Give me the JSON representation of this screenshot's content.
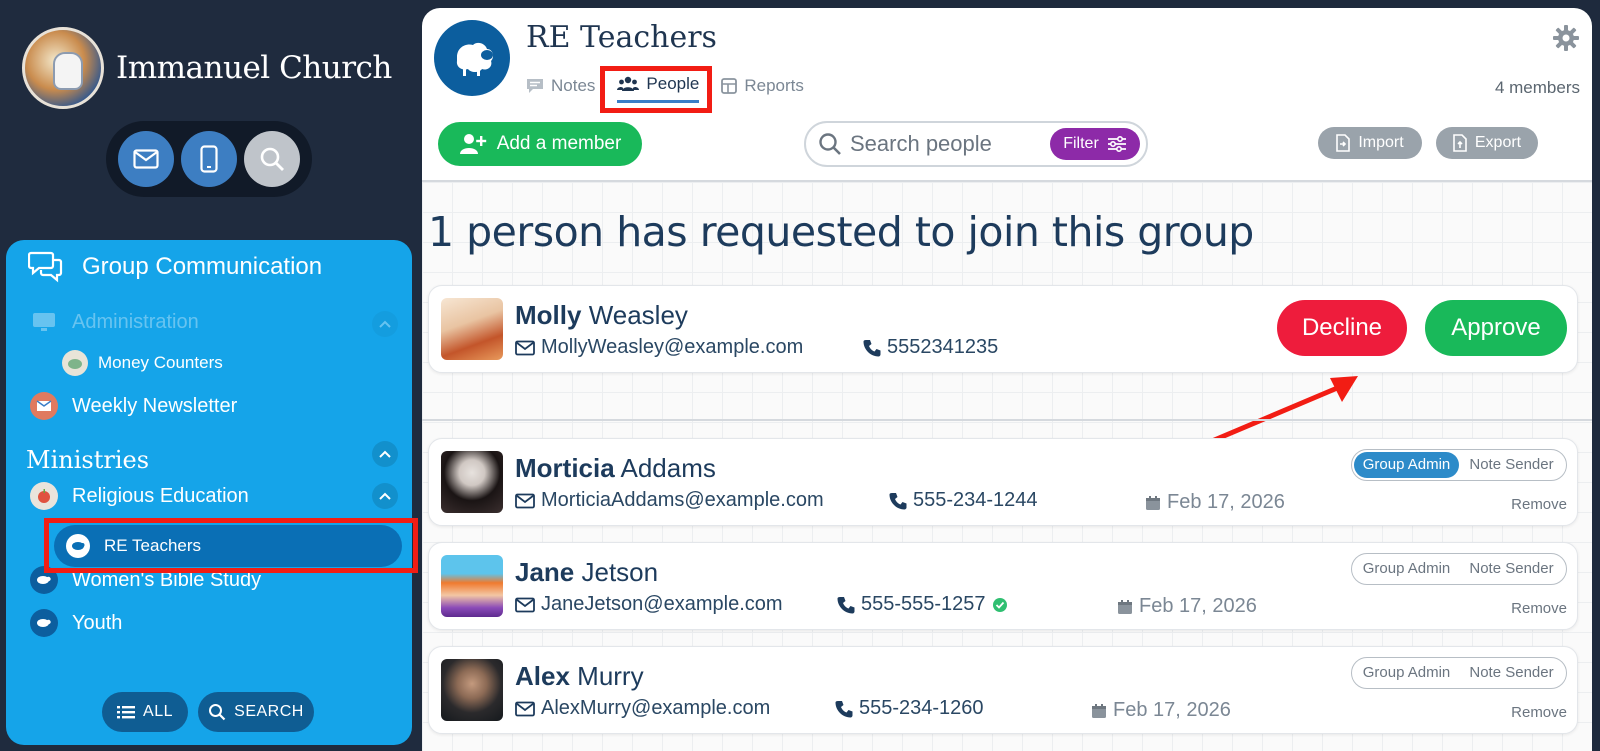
{
  "church": {
    "name": "Immanuel Church"
  },
  "quick_actions": [
    {
      "icon": "mail-icon"
    },
    {
      "icon": "mobile-icon"
    },
    {
      "icon": "search-icon"
    }
  ],
  "sidebar": {
    "section_title": "Group Communication",
    "items": [
      {
        "label": "Administration"
      },
      {
        "label": "Money Counters"
      },
      {
        "label": "Weekly Newsletter"
      }
    ],
    "ministries_label": "Ministries",
    "ministry_items": [
      {
        "label": "Religious Education"
      },
      {
        "label": "RE Teachers"
      },
      {
        "label": "Women's Bible Study"
      },
      {
        "label": "Youth"
      }
    ],
    "all_label": "ALL",
    "search_label": "SEARCH"
  },
  "group": {
    "title": "RE Teachers",
    "tabs": [
      {
        "label": "Notes"
      },
      {
        "label": "People"
      },
      {
        "label": "Reports"
      }
    ],
    "members_count": "4 members"
  },
  "toolbar": {
    "add_member_label": "Add a member",
    "search_placeholder": "Search people",
    "filter_label": "Filter",
    "import_label": "Import",
    "export_label": "Export"
  },
  "requests": {
    "heading": "1 person has requested to join this group",
    "decline_label": "Decline",
    "approve_label": "Approve",
    "person": {
      "first": "Molly",
      "last": "Weasley",
      "email": "MollyWeasley@example.com",
      "phone": "5552341235"
    }
  },
  "members": [
    {
      "first": "Morticia",
      "last": "Addams",
      "email": "MorticiaAddams@example.com",
      "phone": "555-234-1244",
      "date": "Feb 17, 2026",
      "group_admin": true,
      "verified": false
    },
    {
      "first": "Jane",
      "last": "Jetson",
      "email": "JaneJetson@example.com",
      "phone": "555-555-1257",
      "date": "Feb 17, 2026",
      "group_admin": false,
      "verified": true
    },
    {
      "first": "Alex",
      "last": "Murry",
      "email": "AlexMurry@example.com",
      "phone": "555-234-1260",
      "date": "Feb 17, 2026",
      "group_admin": false,
      "verified": false
    }
  ],
  "role_labels": {
    "admin": "Group Admin",
    "sender": "Note Sender",
    "remove": "Remove"
  },
  "colors": {
    "sidebar_bg": "#1f2b3e",
    "panel_bg": "#15a4e9",
    "approve_green": "#19b95a",
    "decline_red": "#ee1c3c",
    "filter_purple": "#8d2aa8",
    "highlight_red": "#f21d14"
  }
}
